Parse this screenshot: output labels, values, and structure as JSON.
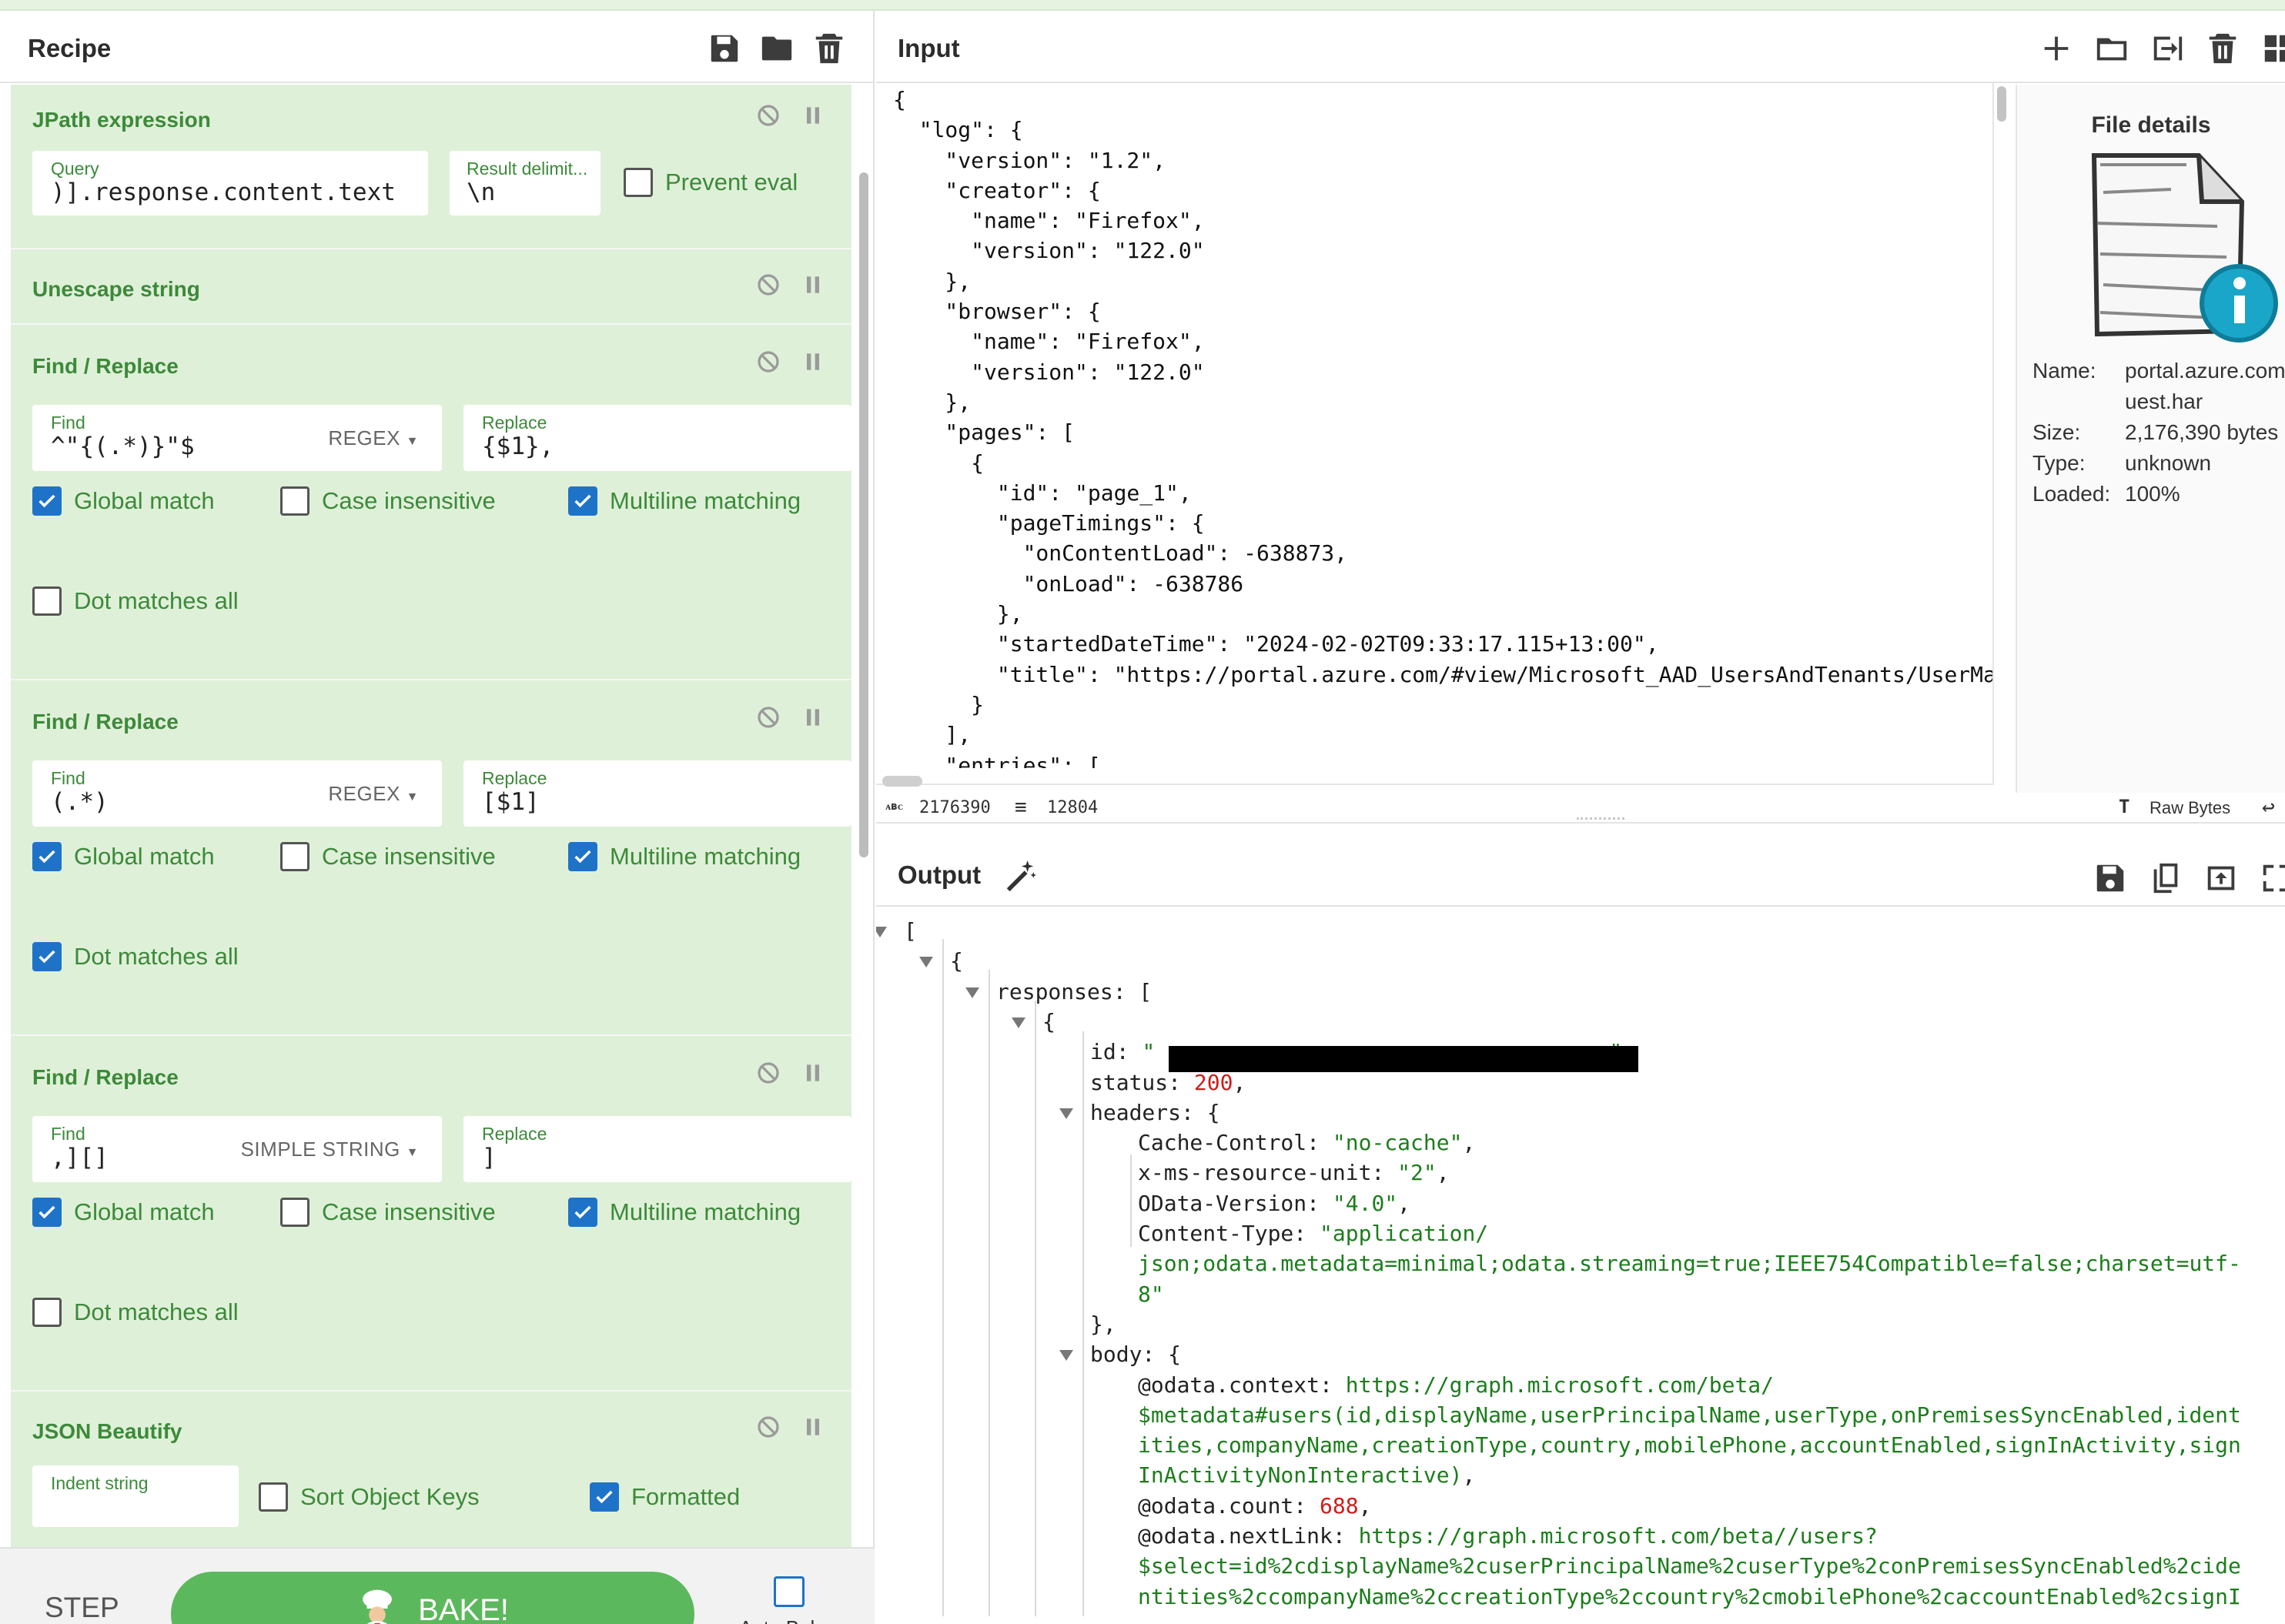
{
  "recipe": {
    "title": "Recipe",
    "operations": [
      {
        "name": "JPath expression",
        "fields": [
          {
            "label": "Query",
            "value": ")].response.content.text"
          },
          {
            "label": "Result delimit...",
            "value": "\\n"
          }
        ],
        "checks": [
          {
            "label": "Prevent eval",
            "checked": false
          }
        ]
      },
      {
        "name": "Unescape string"
      },
      {
        "name": "Find / Replace",
        "find_label": "Find",
        "find_value": "^\"{(.*)}\"$",
        "find_mode": "REGEX",
        "replace_label": "Replace",
        "replace_value": "{$1},",
        "checks": [
          {
            "label": "Global match",
            "checked": true
          },
          {
            "label": "Case insensitive",
            "checked": false
          },
          {
            "label": "Multiline matching",
            "checked": true
          },
          {
            "label": "Dot matches all",
            "checked": false
          }
        ]
      },
      {
        "name": "Find / Replace",
        "find_label": "Find",
        "find_value": "(.*)",
        "find_mode": "REGEX",
        "replace_label": "Replace",
        "replace_value": "[$1]",
        "checks": [
          {
            "label": "Global match",
            "checked": true
          },
          {
            "label": "Case insensitive",
            "checked": false
          },
          {
            "label": "Multiline matching",
            "checked": true
          },
          {
            "label": "Dot matches all",
            "checked": true
          }
        ]
      },
      {
        "name": "Find / Replace",
        "find_label": "Find",
        "find_value": ",][]",
        "find_mode": "SIMPLE STRING",
        "replace_label": "Replace",
        "replace_value": "]",
        "checks": [
          {
            "label": "Global match",
            "checked": true
          },
          {
            "label": "Case insensitive",
            "checked": false
          },
          {
            "label": "Multiline matching",
            "checked": true
          },
          {
            "label": "Dot matches all",
            "checked": false
          }
        ]
      },
      {
        "name": "JSON Beautify",
        "fields": [
          {
            "label": "Indent string",
            "value": ""
          }
        ],
        "checks": [
          {
            "label": "Sort Object Keys",
            "checked": false
          },
          {
            "label": "Formatted",
            "checked": true
          }
        ]
      }
    ],
    "controls": {
      "step": "STEP",
      "bake": "BAKE!",
      "auto_bake": "Auto Bake",
      "auto_bake_checked": false
    }
  },
  "input": {
    "title": "Input",
    "lines": [
      "{",
      "  \"log\": {",
      "    \"version\": \"1.2\",",
      "    \"creator\": {",
      "      \"name\": \"Firefox\",",
      "      \"version\": \"122.0\"",
      "    },",
      "    \"browser\": {",
      "      \"name\": \"Firefox\",",
      "      \"version\": \"122.0\"",
      "    },",
      "    \"pages\": [",
      "      {",
      "        \"id\": \"page_1\",",
      "        \"pageTimings\": {",
      "          \"onContentLoad\": -638873,",
      "          \"onLoad\": -638786",
      "        },",
      "        \"startedDateTime\": \"2024-02-02T09:33:17.115+13:00\",",
      "        \"title\": \"https://portal.azure.com/#view/Microsoft_AAD_UsersAndTenants/UserMa",
      "      }",
      "    ],",
      "    \"entries\": ["
    ],
    "file_details": {
      "title": "File details",
      "name_label": "Name:",
      "name_value_1": "portal.azure.com",
      "name_value_2": "uest.har",
      "size_label": "Size:",
      "size_value": "2,176,390 bytes",
      "type_label": "Type:",
      "type_value": "unknown",
      "loaded_label": "Loaded:",
      "loaded_value": "100%"
    },
    "status": {
      "chars": "2176390",
      "lines": "12804",
      "encoding": "Raw Bytes",
      "chars_icon": "abc-icon",
      "lines_icon": "lines-icon"
    }
  },
  "output": {
    "title": "Output",
    "lines": [
      {
        "indent": 0,
        "tri": true,
        "parts": [
          [
            "k",
            "["
          ]
        ]
      },
      {
        "indent": 1,
        "tri": true,
        "parts": [
          [
            "k",
            "{"
          ]
        ]
      },
      {
        "indent": 2,
        "tri": true,
        "parts": [
          [
            "k",
            "responses: ["
          ]
        ]
      },
      {
        "indent": 3,
        "tri": true,
        "parts": [
          [
            "k",
            "{"
          ]
        ]
      },
      {
        "indent": 4,
        "tri": false,
        "parts": [
          [
            "k",
            "id: "
          ],
          [
            "s",
            "\""
          ],
          [
            "redacted",
            "                                   "
          ],
          [
            "s",
            "\""
          ],
          [
            "k",
            ","
          ]
        ]
      },
      {
        "indent": 4,
        "tri": false,
        "parts": [
          [
            "k",
            "status: "
          ],
          [
            "n",
            "200"
          ],
          [
            "k",
            ","
          ]
        ]
      },
      {
        "indent": 4,
        "tri": true,
        "parts": [
          [
            "k",
            "headers: {"
          ]
        ]
      },
      {
        "indent": 5,
        "tri": false,
        "parts": [
          [
            "k",
            "Cache-Control: "
          ],
          [
            "s",
            "\"no-cache\""
          ],
          [
            "k",
            ","
          ]
        ]
      },
      {
        "indent": 5,
        "tri": false,
        "parts": [
          [
            "k",
            "x-ms-resource-unit: "
          ],
          [
            "s",
            "\"2\""
          ],
          [
            "k",
            ","
          ]
        ]
      },
      {
        "indent": 5,
        "tri": false,
        "parts": [
          [
            "k",
            "OData-Version: "
          ],
          [
            "s",
            "\"4.0\""
          ],
          [
            "k",
            ","
          ]
        ]
      },
      {
        "indent": 5,
        "tri": false,
        "parts": [
          [
            "k",
            "Content-Type: "
          ],
          [
            "s",
            "\"application/"
          ]
        ]
      },
      {
        "indent": 5,
        "tri": false,
        "parts": [
          [
            "s",
            "json;odata.metadata=minimal;odata.streaming=true;IEEE754Compatible=false;charset=utf-"
          ]
        ]
      },
      {
        "indent": 5,
        "tri": false,
        "parts": [
          [
            "s",
            "8\""
          ]
        ]
      },
      {
        "indent": 4,
        "tri": false,
        "parts": [
          [
            "k",
            "},"
          ]
        ]
      },
      {
        "indent": 4,
        "tri": true,
        "parts": [
          [
            "k",
            "body: {"
          ]
        ]
      },
      {
        "indent": 5,
        "tri": false,
        "parts": [
          [
            "k",
            "@odata.context: "
          ],
          [
            "s",
            "https://graph.microsoft.com/beta/"
          ]
        ]
      },
      {
        "indent": 5,
        "tri": false,
        "parts": [
          [
            "s",
            "$metadata#users(id,displayName,userPrincipalName,userType,onPremisesSyncEnabled,ident"
          ]
        ]
      },
      {
        "indent": 5,
        "tri": false,
        "parts": [
          [
            "s",
            "ities,companyName,creationType,country,mobilePhone,accountEnabled,signInActivity,sign"
          ]
        ]
      },
      {
        "indent": 5,
        "tri": false,
        "parts": [
          [
            "s",
            "InActivityNonInteractive)"
          ],
          [
            "k",
            ","
          ]
        ]
      },
      {
        "indent": 5,
        "tri": false,
        "parts": [
          [
            "k",
            "@odata.count: "
          ],
          [
            "n",
            "688"
          ],
          [
            "k",
            ","
          ]
        ]
      },
      {
        "indent": 5,
        "tri": false,
        "parts": [
          [
            "k",
            "@odata.nextLink: "
          ],
          [
            "s",
            "https://graph.microsoft.com/beta//users?"
          ]
        ]
      },
      {
        "indent": 5,
        "tri": false,
        "parts": [
          [
            "s",
            "$select=id%2cdisplayName%2cuserPrincipalName%2cuserType%2conPremisesSyncEnabled%2cide"
          ]
        ]
      },
      {
        "indent": 5,
        "tri": false,
        "parts": [
          [
            "s",
            "ntities%2ccompanyName%2ccreationType%2ccountry%2cmobilePhone%2caccountEnabled%2csignI"
          ]
        ]
      }
    ]
  },
  "colors": {
    "recipe_bg": "#dff0d8",
    "op_title": "#3c8a3a",
    "checkbox_on": "#1e73c9",
    "bake": "#5cb85c",
    "json_string": "#1c7d1c",
    "json_number": "#d21b1b"
  }
}
